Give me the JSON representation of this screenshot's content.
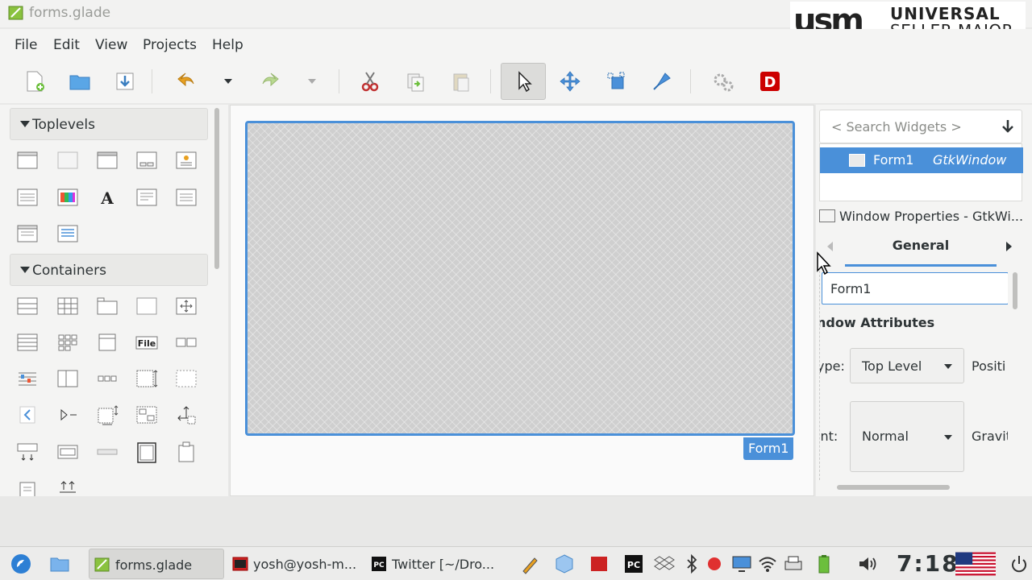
{
  "window": {
    "title": "forms.glade"
  },
  "logo": {
    "mark": "usm",
    "line1": "UNIVERSAL",
    "line2": "SELLER MAJOR"
  },
  "menu": {
    "file": "File",
    "edit": "Edit",
    "view": "View",
    "projects": "Projects",
    "help": "Help"
  },
  "palette": {
    "toplevels": "Toplevels",
    "containers": "Containers",
    "file_widget_label": "File",
    "label_widget_glyph": "A"
  },
  "canvas": {
    "form_tag": "Form1"
  },
  "inspector": {
    "search_placeholder": "< Search Widgets >",
    "tree_name": "Form1",
    "tree_type": "GtkWindow",
    "props_title": "Window Properties - GtkWi...",
    "tab": "General",
    "name_value": "Form1",
    "section": "ndow Attributes",
    "type_label": "ype:",
    "type_value": "Top Level",
    "position_label": "Positi",
    "hint_label": "int:",
    "hint_value": "Normal",
    "gravity_label": "Gravit"
  },
  "taskbar": {
    "task1": "forms.glade",
    "task2": "yosh@yosh-m...",
    "task3": "Twitter [~/Dro...",
    "clock": "7:18"
  },
  "colors": {
    "accent": "#4a90d9",
    "window_bg": "#f4f4f3",
    "danger": "#cc0000"
  }
}
